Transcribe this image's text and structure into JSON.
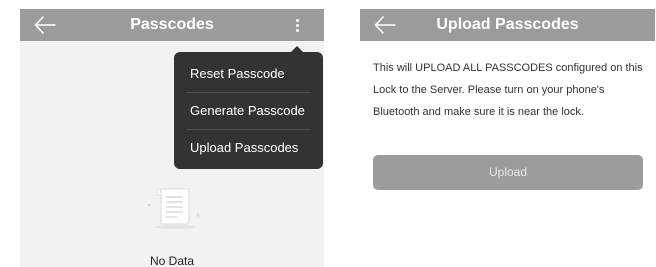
{
  "left_screen": {
    "title": "Passcodes",
    "menu": {
      "items": [
        {
          "label": "Reset Passcode"
        },
        {
          "label": "Generate Passcode"
        },
        {
          "label": "Upload Passcodes"
        }
      ]
    },
    "empty_state": {
      "icon": "document-icon",
      "text": "No Data"
    }
  },
  "right_screen": {
    "title": "Upload Passcodes",
    "description": "This will UPLOAD ALL PASSCODES configured on this Lock to the Server. Please turn on your phone's Bluetooth and make sure it is near the lock.",
    "upload_button": "Upload"
  },
  "colors": {
    "header": "#9b9b9b",
    "menu_background": "#333333",
    "button": "#9c9c9c"
  }
}
